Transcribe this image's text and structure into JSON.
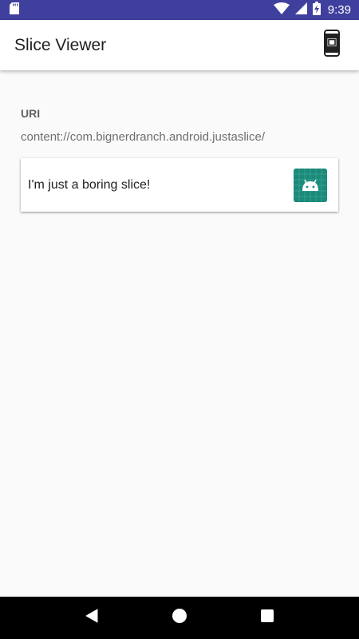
{
  "status_bar": {
    "time": "9:39",
    "background_color": "#3f3f9e",
    "icons": [
      "sd-card-icon",
      "wifi-icon",
      "signal-icon",
      "battery-charging-icon"
    ]
  },
  "app_bar": {
    "title": "Slice Viewer",
    "action_icon": "phone-slice-icon"
  },
  "content": {
    "uri_label": "URI",
    "uri_value": "content://com.bignerdranch.android.justaslice/",
    "slice": {
      "text": "I'm just a boring slice!",
      "icon": "android-icon",
      "icon_background": "#1b8a7a"
    }
  },
  "nav_bar": {
    "buttons": [
      "back-icon",
      "home-icon",
      "recents-icon"
    ]
  }
}
